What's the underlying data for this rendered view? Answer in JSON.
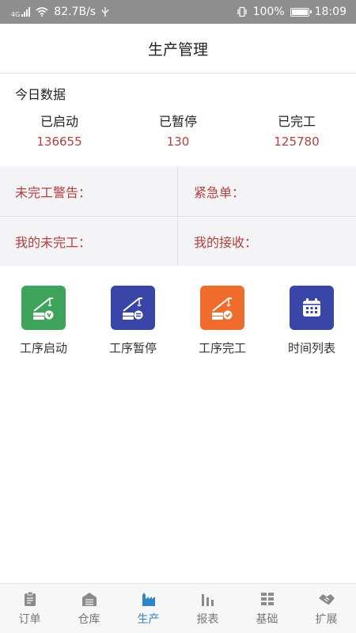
{
  "status_bar": {
    "network": "4G",
    "speed": "82.7B/s",
    "battery": "100%",
    "time": "18:09"
  },
  "header": {
    "title": "生产管理"
  },
  "today": {
    "label": "今日数据",
    "stats": [
      {
        "name": "已启动",
        "value": "136655"
      },
      {
        "name": "已暂停",
        "value": "130"
      },
      {
        "name": "已完工",
        "value": "125780"
      }
    ]
  },
  "alerts": {
    "unfinished_warning": "未完工警告：",
    "urgent": "紧急单：",
    "my_unfinished": "我的未完工：",
    "my_received": "我的接收："
  },
  "actions": [
    {
      "label": "工序启动",
      "icon": "crane-start-icon",
      "color": "#3fa45b"
    },
    {
      "label": "工序暂停",
      "icon": "crane-pause-icon",
      "color": "#3a45a8"
    },
    {
      "label": "工序完工",
      "icon": "crane-complete-icon",
      "color": "#f06c2c"
    },
    {
      "label": "时间列表",
      "icon": "calendar-icon",
      "color": "#3a45a8"
    }
  ],
  "tabbar": {
    "active": "生产",
    "items": [
      {
        "label": "订单",
        "icon": "clipboard-icon"
      },
      {
        "label": "仓库",
        "icon": "warehouse-icon"
      },
      {
        "label": "生产",
        "icon": "factory-icon"
      },
      {
        "label": "报表",
        "icon": "bar-chart-icon"
      },
      {
        "label": "基础",
        "icon": "grid-icon"
      },
      {
        "label": "扩展",
        "icon": "handshake-icon"
      }
    ]
  }
}
